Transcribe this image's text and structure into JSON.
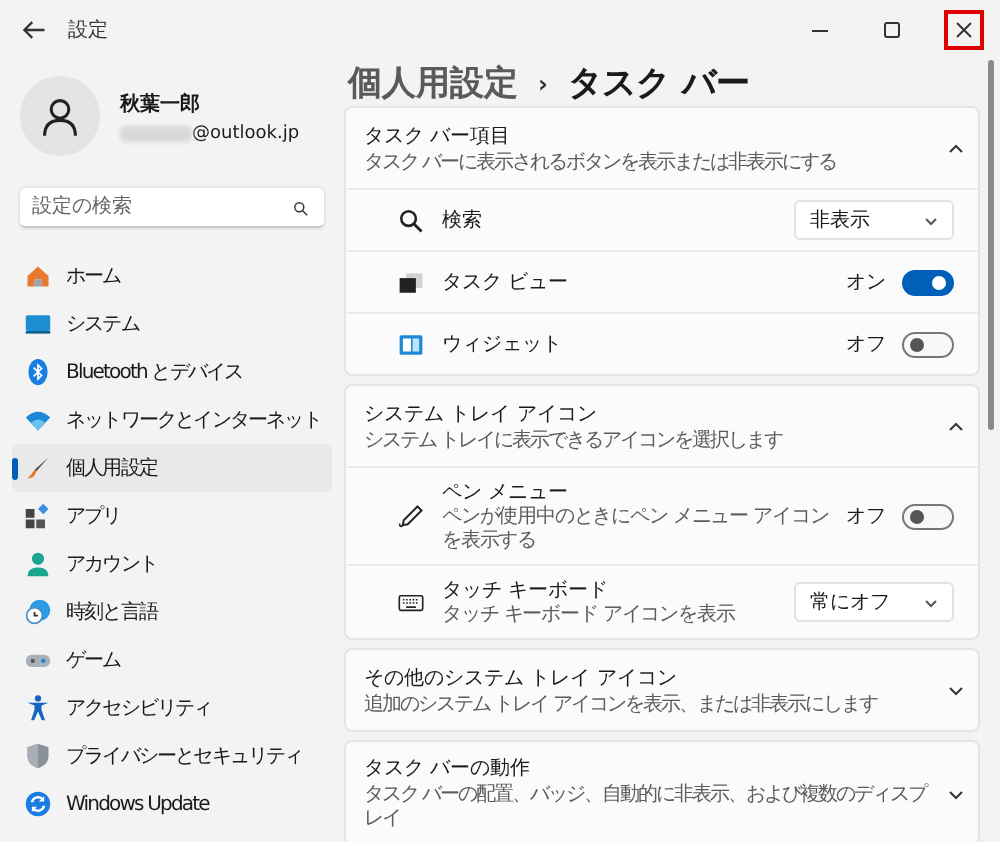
{
  "window": {
    "title": "設定",
    "controls": [
      {
        "kind": "minimize",
        "highlighted": false
      },
      {
        "kind": "maximize",
        "highlighted": false
      },
      {
        "kind": "close",
        "highlighted": true
      }
    ]
  },
  "profile": {
    "name": "秋葉一郎",
    "email": "@outlook.jp"
  },
  "search": {
    "placeholder": "設定の検索"
  },
  "nav": [
    {
      "label": "ホーム",
      "selected": false
    },
    {
      "label": "システム",
      "selected": false
    },
    {
      "label": "Bluetooth とデバイス",
      "selected": false
    },
    {
      "label": "ネットワークとインターネット",
      "selected": false
    },
    {
      "label": "個人用設定",
      "selected": true
    },
    {
      "label": "アプリ",
      "selected": false
    },
    {
      "label": "アカウント",
      "selected": false
    },
    {
      "label": "時刻と言語",
      "selected": false
    },
    {
      "label": "ゲーム",
      "selected": false
    },
    {
      "label": "アクセシビリティ",
      "selected": false
    },
    {
      "label": "プライバシーとセキュリティ",
      "selected": false
    },
    {
      "label": "Windows Update",
      "selected": false
    }
  ],
  "breadcrumb": {
    "parent": "個人用設定",
    "separator": "›",
    "current": "タスク バー"
  },
  "sections": [
    {
      "title": "タスク バー項目",
      "subtitle": "タスク バーに表示されるボタンを表示または非表示にする",
      "expanded": true,
      "rows": [
        {
          "kind": "dropdown",
          "label": "検索",
          "value": "非表示"
        },
        {
          "kind": "toggle",
          "label": "タスク ビュー",
          "state_text": "オン",
          "on": true
        },
        {
          "kind": "toggle",
          "label": "ウィジェット",
          "state_text": "オフ",
          "on": false
        }
      ]
    },
    {
      "title": "システム トレイ アイコン",
      "subtitle": "システム トレイに表示できるアイコンを選択します",
      "expanded": true,
      "rows": [
        {
          "kind": "toggle",
          "label": "ペン メニュー",
          "description": "ペンが使用中のときにペン メニュー アイコンを表示する",
          "state_text": "オフ",
          "on": false
        },
        {
          "kind": "dropdown",
          "label": "タッチ キーボード",
          "description": "タッチ キーボード アイコンを表示",
          "value": "常にオフ"
        }
      ]
    },
    {
      "title": "その他のシステム トレイ アイコン",
      "subtitle": "追加のシステム トレイ アイコンを表示、または非表示にします",
      "expanded": false
    },
    {
      "title": "タスク バーの動作",
      "subtitle": "タスク バーの配置、バッジ、自動的に非表示、および複数のディスプレイ",
      "expanded": false
    }
  ]
}
